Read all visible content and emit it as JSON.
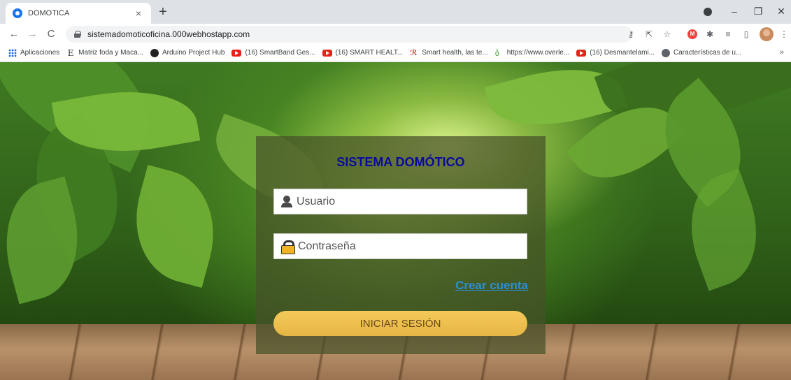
{
  "browser": {
    "tab_title": "DOMOTICA",
    "tab_close": "×",
    "new_tab": "+",
    "url": "sistemadomoticoficina.000webhostapp.com",
    "window_controls": [
      "–",
      "❐",
      "✕"
    ]
  },
  "toolbar": {
    "back": "←",
    "forward": "→",
    "reload": "C"
  },
  "bookmarks": [
    {
      "label": "Aplicaciones",
      "icon": "apps-grid-icon"
    },
    {
      "label": "Matriz foda y Maca...",
      "icon": "e-icon"
    },
    {
      "label": "Arduino Project Hub",
      "icon": "arduino-icon"
    },
    {
      "label": "(16) SmartBand Ges...",
      "icon": "youtube-icon"
    },
    {
      "label": "(16) SMART HEALT...",
      "icon": "youtube-icon"
    },
    {
      "label": "Smart health, las te...",
      "icon": "sh-icon"
    },
    {
      "label": "https://www.overle...",
      "icon": "overleaf-icon"
    },
    {
      "label": "(16) Desmantelami...",
      "icon": "youtube-icon"
    },
    {
      "label": "Características de u...",
      "icon": "globe-icon"
    }
  ],
  "bookmarks_more": "»",
  "login": {
    "title": "SISTEMA DOMÓTICO",
    "username_placeholder": "Usuario",
    "password_placeholder": "Contraseña",
    "create_account": "Crear cuenta",
    "submit": "INICIAR SESIÓN"
  },
  "colors": {
    "title": "#0a0a9c",
    "link": "#2a8fd6",
    "button": "#f3c95a",
    "button_text": "#6b4a1a"
  }
}
